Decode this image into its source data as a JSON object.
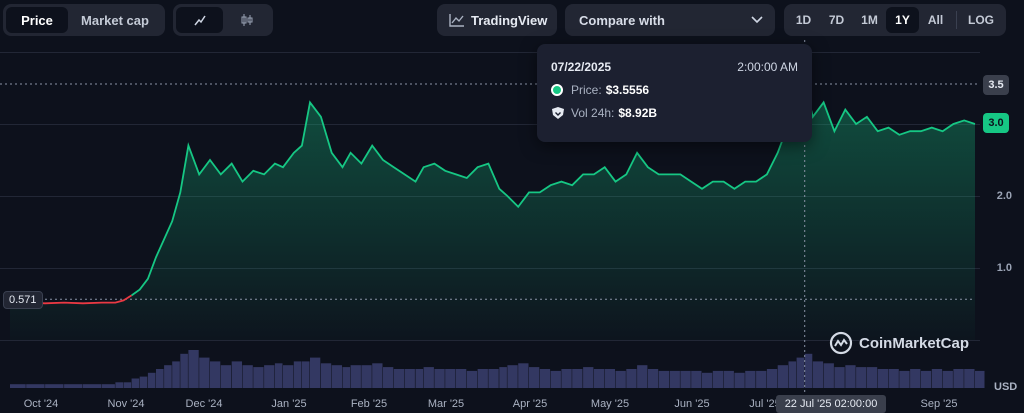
{
  "toolbar": {
    "price_label": "Price",
    "marketcap_label": "Market cap",
    "line_icon": "line-chart-icon",
    "candle_icon": "candlestick-icon",
    "tradingview_label": "TradingView",
    "compare_label": "Compare with",
    "ranges": [
      "1D",
      "7D",
      "1M",
      "1Y",
      "All"
    ],
    "active_range": "1Y",
    "log_label": "LOG"
  },
  "tooltip": {
    "date": "07/22/2025",
    "time": "2:00:00 AM",
    "price_label": "Price:",
    "price_value": "$3.5556",
    "vol_label": "Vol 24h:",
    "vol_value": "$8.92B"
  },
  "watermark": "CoinMarketCap",
  "colors": {
    "up": "#16c784",
    "down": "#ea3943",
    "background": "#0d111c"
  },
  "chart_data": {
    "type": "line",
    "x": [
      "2024-10-01",
      "2024-10-07",
      "2024-10-14",
      "2024-10-21",
      "2024-10-28",
      "2024-11-04",
      "2024-11-09",
      "2024-11-12",
      "2024-11-15",
      "2024-11-18",
      "2024-11-21",
      "2024-11-24",
      "2024-11-27",
      "2024-11-30",
      "2024-12-03",
      "2024-12-06",
      "2024-12-10",
      "2024-12-14",
      "2024-12-18",
      "2024-12-22",
      "2024-12-26",
      "2024-12-30",
      "2025-01-03",
      "2025-01-07",
      "2025-01-10",
      "2025-01-14",
      "2025-01-17",
      "2025-01-20",
      "2025-01-24",
      "2025-01-28",
      "2025-02-01",
      "2025-02-04",
      "2025-02-08",
      "2025-02-12",
      "2025-02-16",
      "2025-02-20",
      "2025-02-24",
      "2025-02-28",
      "2025-03-03",
      "2025-03-07",
      "2025-03-11",
      "2025-03-15",
      "2025-03-19",
      "2025-03-23",
      "2025-03-27",
      "2025-03-31",
      "2025-04-03",
      "2025-04-07",
      "2025-04-11",
      "2025-04-15",
      "2025-04-19",
      "2025-04-23",
      "2025-04-27",
      "2025-05-01",
      "2025-05-05",
      "2025-05-09",
      "2025-05-13",
      "2025-05-17",
      "2025-05-21",
      "2025-05-25",
      "2025-05-29",
      "2025-06-02",
      "2025-06-06",
      "2025-06-10",
      "2025-06-14",
      "2025-06-18",
      "2025-06-22",
      "2025-06-26",
      "2025-06-30",
      "2025-07-04",
      "2025-07-08",
      "2025-07-12",
      "2025-07-16",
      "2025-07-19",
      "2025-07-22",
      "2025-07-25",
      "2025-07-29",
      "2025-08-02",
      "2025-08-06",
      "2025-08-10",
      "2025-08-14",
      "2025-08-18",
      "2025-08-22",
      "2025-08-26",
      "2025-08-30",
      "2025-09-03",
      "2025-09-07",
      "2025-09-11",
      "2025-09-15",
      "2025-09-19",
      "2025-09-23"
    ],
    "y": [
      0.58,
      0.52,
      0.51,
      0.52,
      0.51,
      0.52,
      0.52,
      0.55,
      0.62,
      0.7,
      0.85,
      1.15,
      1.4,
      1.65,
      2.05,
      2.7,
      2.3,
      2.5,
      2.3,
      2.45,
      2.2,
      2.35,
      2.3,
      2.45,
      2.4,
      2.6,
      2.7,
      3.3,
      3.1,
      2.6,
      2.4,
      2.6,
      2.45,
      2.7,
      2.5,
      2.4,
      2.3,
      2.2,
      2.4,
      2.45,
      2.35,
      2.3,
      2.25,
      2.4,
      2.45,
      2.1,
      2.0,
      1.85,
      2.05,
      2.05,
      2.15,
      2.2,
      2.15,
      2.3,
      2.3,
      2.4,
      2.2,
      2.3,
      2.6,
      2.4,
      2.3,
      2.3,
      2.3,
      2.2,
      2.1,
      2.2,
      2.2,
      2.1,
      2.2,
      2.2,
      2.3,
      2.6,
      3.0,
      3.4,
      3.5556,
      3.1,
      3.3,
      2.9,
      3.2,
      3.0,
      3.1,
      2.9,
      2.95,
      2.85,
      2.9,
      2.9,
      2.95,
      2.9,
      3.0,
      3.05,
      3.0
    ],
    "series_name": "",
    "x_ticks": [
      "Oct '24",
      "Nov '24",
      "Dec '24",
      "Jan '25",
      "Feb '25",
      "Mar '25",
      "Apr '25",
      "May '25",
      "Jun '25",
      "Jul '25",
      "22 Jul '25 02:00:00",
      "Sep '25"
    ],
    "y_ticks": [
      "1.0",
      "2.0",
      "3.0",
      "3.5"
    ],
    "y_unit": "USD",
    "ylim": [
      0,
      3.9
    ],
    "start_label": "0.571",
    "last_value_label": "3.0",
    "high_label": "3.5",
    "grid": true,
    "volume": [
      2,
      2,
      2,
      2,
      2,
      2,
      3,
      3,
      5,
      6,
      8,
      10,
      12,
      14,
      18,
      20,
      16,
      14,
      12,
      14,
      12,
      11,
      12,
      13,
      12,
      14,
      14,
      16,
      13,
      12,
      11,
      12,
      12,
      13,
      11,
      10,
      10,
      10,
      11,
      10,
      10,
      10,
      9,
      10,
      10,
      11,
      12,
      13,
      11,
      10,
      9,
      10,
      10,
      11,
      10,
      10,
      9,
      10,
      12,
      10,
      9,
      9,
      9,
      9,
      8,
      9,
      9,
      8,
      9,
      9,
      10,
      12,
      14,
      16,
      18,
      14,
      13,
      11,
      12,
      11,
      11,
      10,
      10,
      9,
      10,
      9,
      10,
      9,
      10,
      10,
      9
    ]
  }
}
